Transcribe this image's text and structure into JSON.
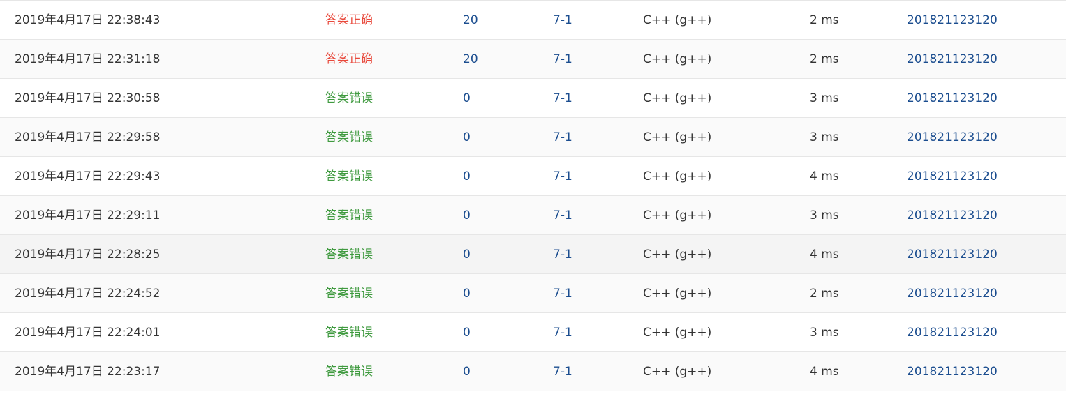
{
  "submissions": [
    {
      "submit_time": "2019年4月17日 22:38:43",
      "status": "答案正确",
      "status_type": "ok",
      "score": "20",
      "problem": "7-1",
      "compiler": "C++ (g++)",
      "time_used": "2 ms",
      "user": "201821123120"
    },
    {
      "submit_time": "2019年4月17日 22:31:18",
      "status": "答案正确",
      "status_type": "ok",
      "score": "20",
      "problem": "7-1",
      "compiler": "C++ (g++)",
      "time_used": "2 ms",
      "user": "201821123120"
    },
    {
      "submit_time": "2019年4月17日 22:30:58",
      "status": "答案错误",
      "status_type": "wrong",
      "score": "0",
      "problem": "7-1",
      "compiler": "C++ (g++)",
      "time_used": "3 ms",
      "user": "201821123120"
    },
    {
      "submit_time": "2019年4月17日 22:29:58",
      "status": "答案错误",
      "status_type": "wrong",
      "score": "0",
      "problem": "7-1",
      "compiler": "C++ (g++)",
      "time_used": "3 ms",
      "user": "201821123120"
    },
    {
      "submit_time": "2019年4月17日 22:29:43",
      "status": "答案错误",
      "status_type": "wrong",
      "score": "0",
      "problem": "7-1",
      "compiler": "C++ (g++)",
      "time_used": "4 ms",
      "user": "201821123120"
    },
    {
      "submit_time": "2019年4月17日 22:29:11",
      "status": "答案错误",
      "status_type": "wrong",
      "score": "0",
      "problem": "7-1",
      "compiler": "C++ (g++)",
      "time_used": "3 ms",
      "user": "201821123120"
    },
    {
      "submit_time": "2019年4月17日 22:28:25",
      "status": "答案错误",
      "status_type": "wrong",
      "score": "0",
      "problem": "7-1",
      "compiler": "C++ (g++)",
      "time_used": "4 ms",
      "user": "201821123120"
    },
    {
      "submit_time": "2019年4月17日 22:24:52",
      "status": "答案错误",
      "status_type": "wrong",
      "score": "0",
      "problem": "7-1",
      "compiler": "C++ (g++)",
      "time_used": "2 ms",
      "user": "201821123120"
    },
    {
      "submit_time": "2019年4月17日 22:24:01",
      "status": "答案错误",
      "status_type": "wrong",
      "score": "0",
      "problem": "7-1",
      "compiler": "C++ (g++)",
      "time_used": "3 ms",
      "user": "201821123120"
    },
    {
      "submit_time": "2019年4月17日 22:23:17",
      "status": "答案错误",
      "status_type": "wrong",
      "score": "0",
      "problem": "7-1",
      "compiler": "C++ (g++)",
      "time_used": "4 ms",
      "user": "201821123120"
    }
  ],
  "colors": {
    "status_ok": "#e8483b",
    "status_wrong": "#3f9a3f",
    "link": "#1b4d8f",
    "text": "#333333",
    "row_alt": "#fafafa",
    "row_hover": "#f4f4f4",
    "border": "#e6e6e6"
  }
}
